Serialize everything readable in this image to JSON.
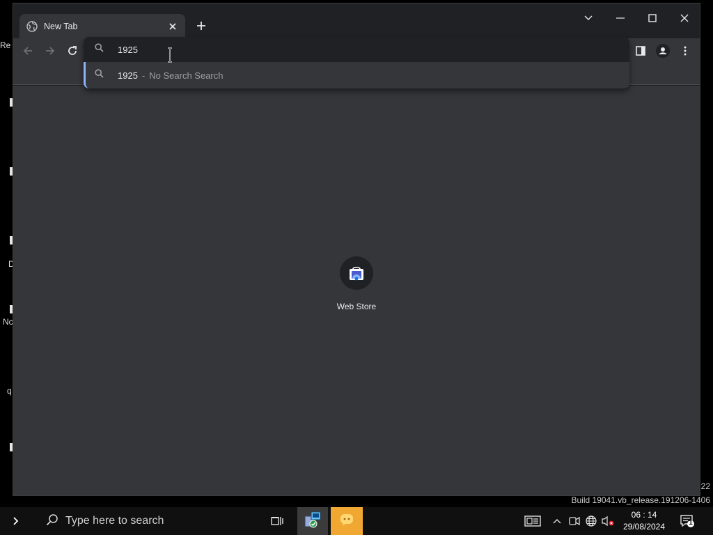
{
  "browser": {
    "tab_title": "New Tab",
    "omnibox": {
      "value": "1925",
      "suggestion_query": "1925",
      "suggestion_separator": "-",
      "suggestion_description": "No Search Search"
    },
    "shortcut_label": "Web Store",
    "accent_color": "#8ab4f8"
  },
  "desktop": {
    "left_fragments": [
      "Re",
      "D",
      "Nc",
      "q"
    ],
    "watermark_line1": "22",
    "watermark_line2": "Build 19041.vb_release.191206-1406"
  },
  "taskbar": {
    "search_placeholder": "Type here to search",
    "time": "06 : 14",
    "date": "29/08/2024",
    "notification_count": "1"
  }
}
